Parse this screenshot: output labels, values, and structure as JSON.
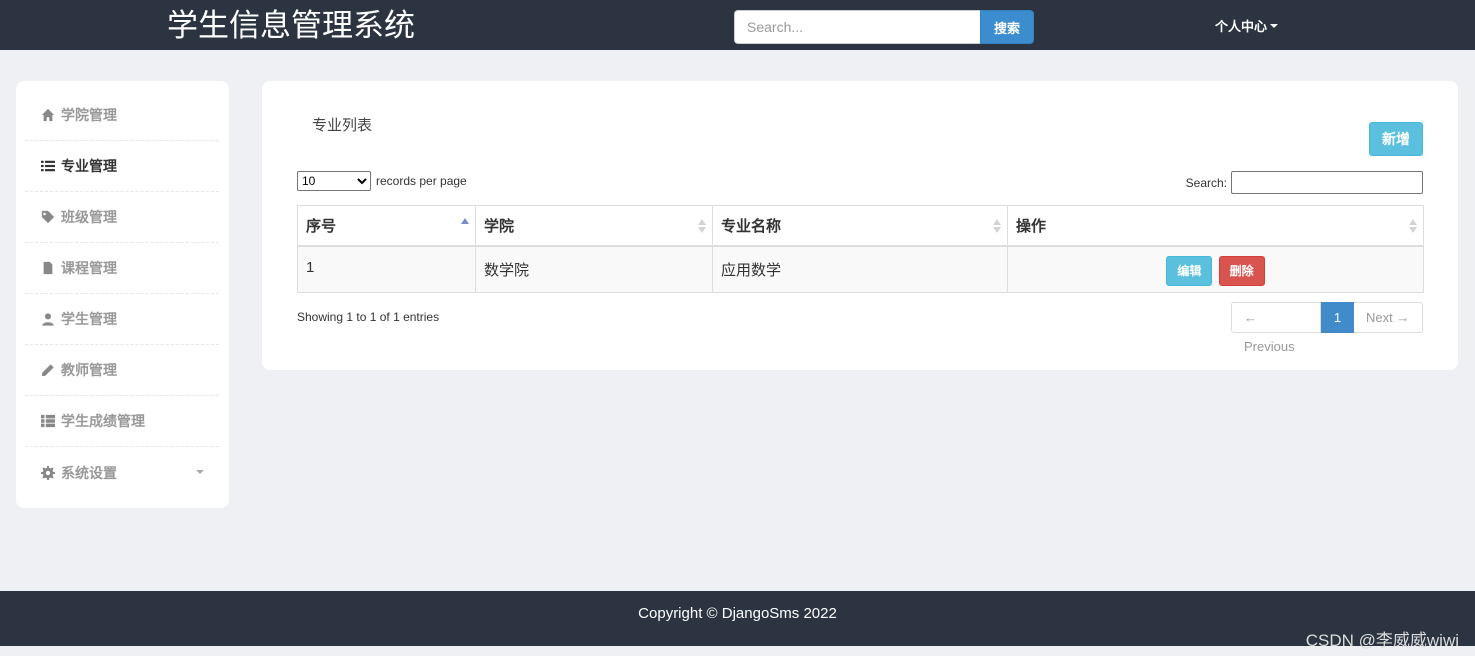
{
  "navbar": {
    "brand": "学生信息管理系统",
    "search_placeholder": "Search...",
    "search_button": "搜索",
    "user_menu": "个人中心"
  },
  "sidebar": {
    "items": [
      {
        "label": "学院管理",
        "icon": "home-icon"
      },
      {
        "label": "专业管理",
        "icon": "list-icon",
        "active": true
      },
      {
        "label": "班级管理",
        "icon": "tag-icon"
      },
      {
        "label": "课程管理",
        "icon": "file-icon"
      },
      {
        "label": "学生管理",
        "icon": "user-icon"
      },
      {
        "label": "教师管理",
        "icon": "pencil-icon"
      },
      {
        "label": "学生成绩管理",
        "icon": "grid-list-icon"
      },
      {
        "label": "系统设置",
        "icon": "gear-icon",
        "has_dropdown": true
      }
    ]
  },
  "panel": {
    "title": "专业列表",
    "add_button": "新增",
    "length_value": "10",
    "length_suffix": "records per page",
    "search_label": "Search:",
    "columns": [
      "序号",
      "学院",
      "专业名称",
      "操作"
    ],
    "rows": [
      {
        "id": "1",
        "college": "数学院",
        "major": "应用数学",
        "edit": "编辑",
        "delete": "删除"
      }
    ],
    "info": "Showing 1 to 1 of 1 entries",
    "pager": {
      "prev": "← Previous",
      "current": "1",
      "next": "Next →"
    }
  },
  "footer": {
    "copyright": "Copyright © DjangoSms 2022",
    "watermark": "CSDN @李威威wiwi"
  },
  "colors": {
    "navbar_bg": "#2b3440",
    "page_bg": "#eef0f3",
    "primary": "#428bca",
    "info": "#5bc0de",
    "danger": "#d9534f"
  }
}
